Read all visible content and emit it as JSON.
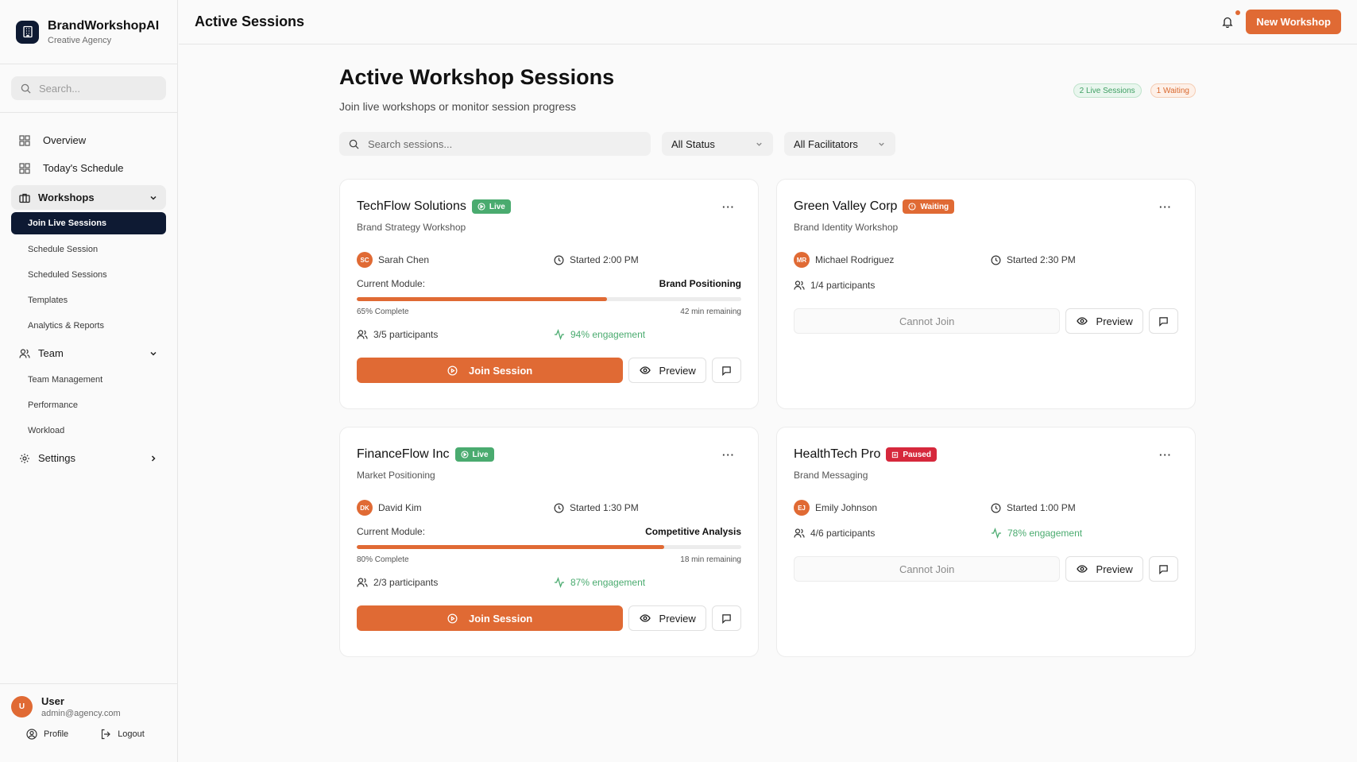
{
  "brand": {
    "name": "BrandWorkshopAI",
    "subtitle": "Creative Agency"
  },
  "sidebar": {
    "search_placeholder": "Search...",
    "overview": "Overview",
    "schedule": "Today's Schedule",
    "workshops": {
      "label": "Workshops",
      "items": [
        "Join Live Sessions",
        "Schedule Session",
        "Scheduled Sessions",
        "Templates",
        "Analytics & Reports"
      ]
    },
    "team": {
      "label": "Team",
      "items": [
        "Team Management",
        "Performance",
        "Workload"
      ]
    },
    "settings": "Settings",
    "user": {
      "initial": "U",
      "name": "User",
      "email": "admin@agency.com"
    },
    "profile": "Profile",
    "logout": "Logout"
  },
  "topbar": {
    "title": "Active Sessions",
    "new_button": "New Workshop"
  },
  "main": {
    "title": "Active Workshop Sessions",
    "subtitle": "Join live workshops or monitor session progress",
    "badge_live": "2 Live Sessions",
    "badge_waiting": "1 Waiting",
    "search_placeholder": "Search sessions...",
    "status_filter": "All Status",
    "facilitator_filter": "All Facilitators"
  },
  "labels": {
    "current_module": "Current Module:",
    "join": "Join Session",
    "cannot_join": "Cannot Join",
    "preview": "Preview"
  },
  "sessions": [
    {
      "client": "TechFlow Solutions",
      "status": "Live",
      "type": "Brand Strategy Workshop",
      "facilitator_initials": "SC",
      "facilitator": "Sarah Chen",
      "started": "Started 2:00 PM",
      "module": "Brand Positioning",
      "progress": 65,
      "progress_label": "65% Complete",
      "remaining": "42 min remaining",
      "participants": "3/5 participants",
      "engagement": "94% engagement"
    },
    {
      "client": "Green Valley Corp",
      "status": "Waiting",
      "type": "Brand Identity Workshop",
      "facilitator_initials": "MR",
      "facilitator": "Michael Rodriguez",
      "started": "Started 2:30 PM",
      "participants": "1/4 participants"
    },
    {
      "client": "FinanceFlow Inc",
      "status": "Live",
      "type": "Market Positioning",
      "facilitator_initials": "DK",
      "facilitator": "David Kim",
      "started": "Started 1:30 PM",
      "module": "Competitive Analysis",
      "progress": 80,
      "progress_label": "80% Complete",
      "remaining": "18 min remaining",
      "participants": "2/3 participants",
      "engagement": "87% engagement"
    },
    {
      "client": "HealthTech Pro",
      "status": "Paused",
      "type": "Brand Messaging",
      "facilitator_initials": "EJ",
      "facilitator": "Emily Johnson",
      "started": "Started 1:00 PM",
      "participants": "4/6 participants",
      "engagement": "78% engagement"
    }
  ],
  "colors": {
    "accent": "#e06a34",
    "navy": "#0e1a33",
    "live": "#4aab6f",
    "paused": "#d6283c"
  }
}
